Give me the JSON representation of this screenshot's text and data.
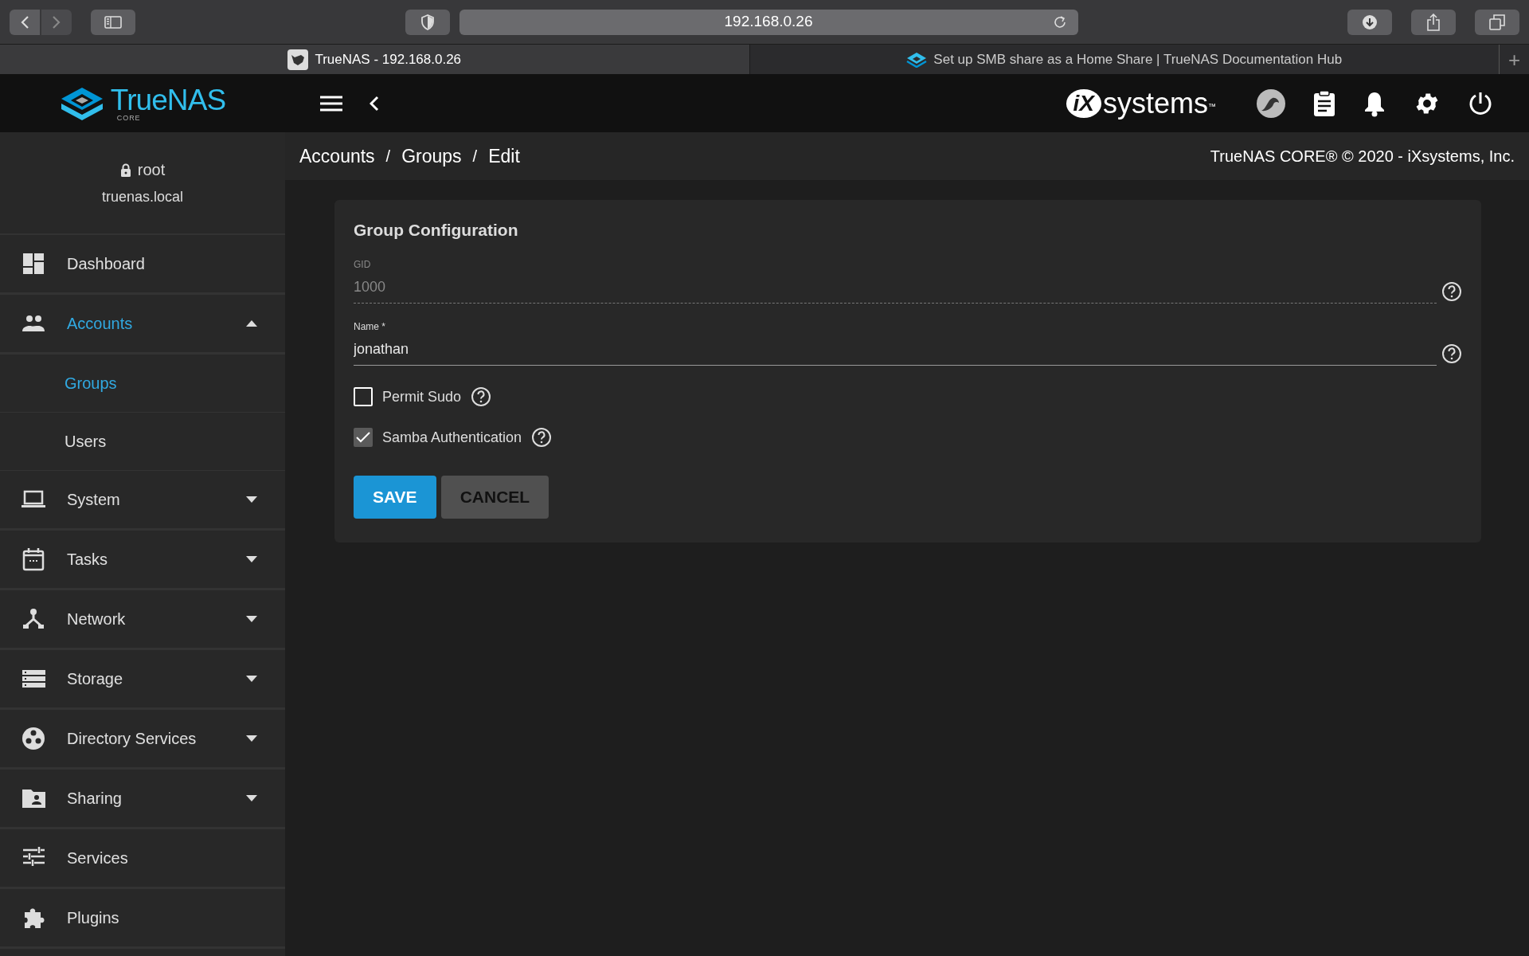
{
  "browser": {
    "address": "192.168.0.26",
    "tabs": [
      {
        "title": "TrueNAS - 192.168.0.26",
        "selected": true
      },
      {
        "title": "Set up SMB share as a Home Share | TrueNAS Documentation Hub",
        "selected": false
      }
    ],
    "new_tab": "+"
  },
  "topbar": {
    "logo": {
      "name": "TrueNAS",
      "edition": "CORE"
    },
    "vendor_logo": {
      "mark": "iX",
      "name": "systems",
      "tm": "™"
    }
  },
  "user": {
    "name": "root",
    "host": "truenas.local"
  },
  "sidebar": {
    "items": [
      {
        "label": "Dashboard",
        "kind": "link",
        "selected": false
      },
      {
        "label": "Accounts",
        "kind": "group",
        "selected": true,
        "expanded": true,
        "children": [
          {
            "label": "Groups",
            "selected": true
          },
          {
            "label": "Users",
            "selected": false
          }
        ]
      },
      {
        "label": "System",
        "kind": "group",
        "selected": false,
        "expanded": false
      },
      {
        "label": "Tasks",
        "kind": "group",
        "selected": false,
        "expanded": false
      },
      {
        "label": "Network",
        "kind": "group",
        "selected": false,
        "expanded": false
      },
      {
        "label": "Storage",
        "kind": "group",
        "selected": false,
        "expanded": false
      },
      {
        "label": "Directory Services",
        "kind": "group",
        "selected": false,
        "expanded": false
      },
      {
        "label": "Sharing",
        "kind": "group",
        "selected": false,
        "expanded": false
      },
      {
        "label": "Services",
        "kind": "link",
        "selected": false
      },
      {
        "label": "Plugins",
        "kind": "link",
        "selected": false
      }
    ]
  },
  "breadcrumb": [
    {
      "label": "Accounts",
      "separator": "/"
    },
    {
      "label": "Groups",
      "separator": "/"
    },
    {
      "label": "Edit"
    }
  ],
  "copyright": "TrueNAS CORE® © 2020 - iXsystems, Inc.",
  "form": {
    "title": "Group Configuration",
    "fields": [
      {
        "label": "GID",
        "value": "1000",
        "disabled": true
      },
      {
        "label": "Name *",
        "value": "jonathan",
        "disabled": false
      }
    ],
    "checkboxes": [
      {
        "label": "Permit Sudo",
        "checked": false
      },
      {
        "label": "Samba Authentication",
        "checked": true
      }
    ],
    "buttons": [
      {
        "label": "SAVE",
        "kind": "primary"
      },
      {
        "label": "CANCEL",
        "kind": "secondary"
      }
    ]
  }
}
